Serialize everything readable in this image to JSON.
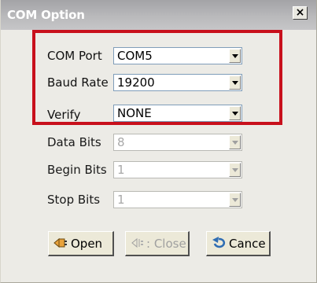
{
  "window": {
    "title": "COM Option",
    "close_label": "×"
  },
  "fields": {
    "com_port": {
      "label": "COM Port",
      "value": "COM5",
      "enabled": true
    },
    "baud_rate": {
      "label": "Baud Rate",
      "value": "19200",
      "enabled": true
    },
    "verify": {
      "label": "Verify",
      "value": "NONE",
      "enabled": true
    },
    "data_bits": {
      "label": "Data Bits",
      "value": "8",
      "enabled": false
    },
    "begin_bits": {
      "label": "Begin Bits",
      "value": "1",
      "enabled": false
    },
    "stop_bits": {
      "label": "Stop Bits",
      "value": "1",
      "enabled": false
    }
  },
  "buttons": {
    "open": {
      "label": "Open",
      "icon": "plug-icon",
      "enabled": true
    },
    "close": {
      "label": "Close",
      "icon": "unplug-icon",
      "enabled": false
    },
    "cancel": {
      "label": "Cance",
      "icon": "undo-icon",
      "enabled": true
    }
  },
  "colors": {
    "highlight": "#c8101c",
    "title_text": "#ffffff",
    "disabled_text": "#a8a8a8"
  }
}
